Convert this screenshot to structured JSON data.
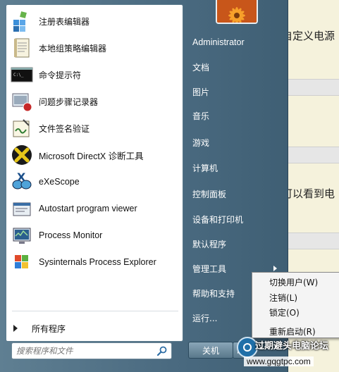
{
  "background_window": {
    "text_line1": "自定义电源",
    "text_line2": "可以看到电"
  },
  "start_menu": {
    "programs": [
      {
        "label": "注册表编辑器",
        "icon": "registry-editor-icon"
      },
      {
        "label": "本地组策略编辑器",
        "icon": "group-policy-icon"
      },
      {
        "label": "命令提示符",
        "icon": "command-prompt-icon"
      },
      {
        "label": "问题步骤记录器",
        "icon": "steps-recorder-icon"
      },
      {
        "label": "文件签名验证",
        "icon": "file-signature-icon"
      },
      {
        "label": "Microsoft DirectX 诊断工具",
        "icon": "directx-icon"
      },
      {
        "label": "eXeScope",
        "icon": "exescope-icon"
      },
      {
        "label": "Autostart program viewer",
        "icon": "autostart-viewer-icon"
      },
      {
        "label": "Process Monitor",
        "icon": "process-monitor-icon"
      },
      {
        "label": "Sysinternals Process Explorer",
        "icon": "process-explorer-icon"
      }
    ],
    "all_programs": "所有程序",
    "search_placeholder": "搜索程序和文件",
    "right_items": [
      {
        "label": "Administrator"
      },
      {
        "label": "文档"
      },
      {
        "label": "图片"
      },
      {
        "label": "音乐"
      },
      {
        "label": "游戏"
      },
      {
        "label": "计算机"
      },
      {
        "label": "控制面板"
      },
      {
        "label": "设备和打印机"
      },
      {
        "label": "默认程序"
      },
      {
        "label": "管理工具",
        "has_submenu": true
      },
      {
        "label": "帮助和支持"
      },
      {
        "label": "运行..."
      }
    ],
    "shutdown_label": "关机"
  },
  "power_submenu": {
    "items": [
      "切换用户(W)",
      "注销(L)",
      "锁定(O)",
      "重新启动(R)"
    ]
  },
  "watermark": {
    "title": "过期避头电脑论坛",
    "url": "www.gqgtpc.com"
  },
  "colors": {
    "menu_frame": "#4a6a80",
    "left_pane": "#ffffff",
    "right_text": "#ffffff"
  }
}
